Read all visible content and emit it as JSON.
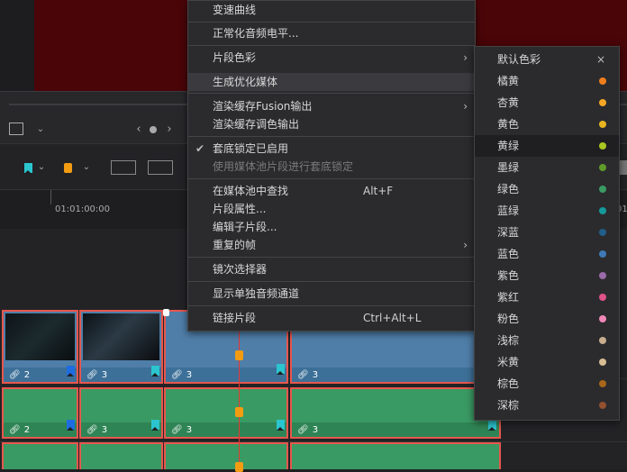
{
  "ruler": {
    "timecode": "01:01:00:00",
    "timecode_right": "01:0"
  },
  "clips": {
    "video": [
      "2",
      "3",
      "3",
      "3"
    ],
    "audio1": [
      "2",
      "3",
      "3",
      "3"
    ]
  },
  "menu": {
    "items": [
      {
        "label": "变速曲线"
      },
      {
        "label": "正常化音频电平..."
      },
      {
        "label": "片段色彩",
        "submenu": true
      },
      {
        "label": "生成优化媒体",
        "highlighted": true
      },
      {
        "label": "渲染缓存Fusion输出",
        "submenu": true
      },
      {
        "label": "渲染缓存调色输出"
      },
      {
        "label": "套底锁定已启用",
        "checked": true
      },
      {
        "label": "使用媒体池片段进行套底锁定",
        "disabled": true
      },
      {
        "label": "在媒体池中查找",
        "shortcut": "Alt+F"
      },
      {
        "label": "片段属性..."
      },
      {
        "label": "编辑子片段..."
      },
      {
        "label": "重复的帧",
        "submenu": true
      },
      {
        "label": "镜次选择器"
      },
      {
        "label": "显示单独音频通道"
      },
      {
        "label": "链接片段",
        "shortcut": "Ctrl+Alt+L"
      }
    ]
  },
  "submenu": {
    "items": [
      {
        "label": "默认色彩",
        "color": ""
      },
      {
        "label": "橘黄",
        "color": "#f07e1c"
      },
      {
        "label": "杏黄",
        "color": "#f5a623"
      },
      {
        "label": "黄色",
        "color": "#e8b520"
      },
      {
        "label": "黄绿",
        "color": "#a8c821"
      },
      {
        "label": "墨绿",
        "color": "#5f9a2a"
      },
      {
        "label": "绿色",
        "color": "#3a9a63"
      },
      {
        "label": "蓝绿",
        "color": "#15999b"
      },
      {
        "label": "深蓝",
        "color": "#215f8a"
      },
      {
        "label": "蓝色",
        "color": "#3f78b5"
      },
      {
        "label": "紫色",
        "color": "#9b6aa8"
      },
      {
        "label": "紫红",
        "color": "#e0528a"
      },
      {
        "label": "粉色",
        "color": "#f088b8"
      },
      {
        "label": "浅棕",
        "color": "#c8ad8e"
      },
      {
        "label": "米黄",
        "color": "#d8bc92"
      },
      {
        "label": "棕色",
        "color": "#a8661a"
      },
      {
        "label": "深棕",
        "color": "#93512f"
      }
    ],
    "close_glyph": "×"
  }
}
